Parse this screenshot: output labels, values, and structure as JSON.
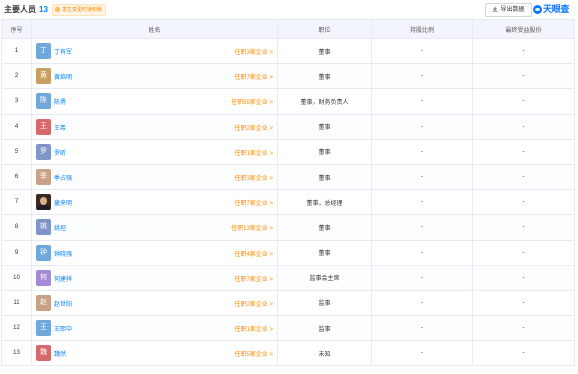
{
  "header": {
    "title": "主要人员",
    "count": "13",
    "badge_text": "发生变更时通知我",
    "export_label": "导出数据",
    "logo_text": "天眼查"
  },
  "table": {
    "columns": [
      "序号",
      "姓名",
      "职位",
      "持股比例",
      "最终受益股份"
    ],
    "rows": [
      {
        "idx": "1",
        "avatar": "丁",
        "color": "#6fa8dc",
        "name": "丁有军",
        "link": "任职3家企业",
        "position": "董事",
        "ratio": "-",
        "final": "-"
      },
      {
        "idx": "2",
        "avatar": "黄",
        "color": "#c9a063",
        "name": "黄焰明",
        "link": "任职7家企业",
        "position": "董事",
        "ratio": "-",
        "final": "-"
      },
      {
        "idx": "3",
        "avatar": "陈",
        "color": "#6fa8dc",
        "name": "陈勇",
        "link": "任职69家企业",
        "position": "董事，财务负责人",
        "ratio": "-",
        "final": "-"
      },
      {
        "idx": "4",
        "avatar": "王",
        "color": "#d66a6a",
        "name": "王希",
        "link": "任职2家企业",
        "position": "董事",
        "ratio": "-",
        "final": "-"
      },
      {
        "idx": "5",
        "avatar": "罗",
        "color": "#7f95c9",
        "name": "罗昕",
        "link": "任职1家企业",
        "position": "董事",
        "ratio": "-",
        "final": "-"
      },
      {
        "idx": "6",
        "avatar": "季",
        "color": "#c8a186",
        "name": "季占强",
        "link": "任职3家企业",
        "position": "董事",
        "ratio": "-",
        "final": "-"
      },
      {
        "idx": "7",
        "avatar": "",
        "color": "#3a2a22",
        "photo": true,
        "name": "童来明",
        "link": "任职7家企业",
        "position": "董事，总经理",
        "ratio": "-",
        "final": "-"
      },
      {
        "idx": "8",
        "avatar": "姚",
        "color": "#7f95c9",
        "name": "姚坦",
        "link": "任职13家企业",
        "position": "董事",
        "ratio": "-",
        "final": "-"
      },
      {
        "idx": "9",
        "avatar": "钟",
        "color": "#6fa8dc",
        "name": "钟晓强",
        "link": "任职4家企业",
        "position": "董事",
        "ratio": "-",
        "final": "-"
      },
      {
        "idx": "10",
        "avatar": "何",
        "color": "#a68ad6",
        "name": "何建祥",
        "link": "任职7家企业",
        "position": "监事会主席",
        "ratio": "-",
        "final": "-"
      },
      {
        "idx": "11",
        "avatar": "赵",
        "color": "#c8a186",
        "name": "赵世阳",
        "link": "任职2家企业",
        "position": "监事",
        "ratio": "-",
        "final": "-"
      },
      {
        "idx": "12",
        "avatar": "王",
        "color": "#6fa8dc",
        "name": "王熙中",
        "link": "任职1家企业",
        "position": "监事",
        "ratio": "-",
        "final": "-"
      },
      {
        "idx": "13",
        "avatar": "魏",
        "color": "#d66a6a",
        "name": "魏然",
        "link": "任职5家企业",
        "position": "未知",
        "ratio": "-",
        "final": "-"
      }
    ]
  }
}
